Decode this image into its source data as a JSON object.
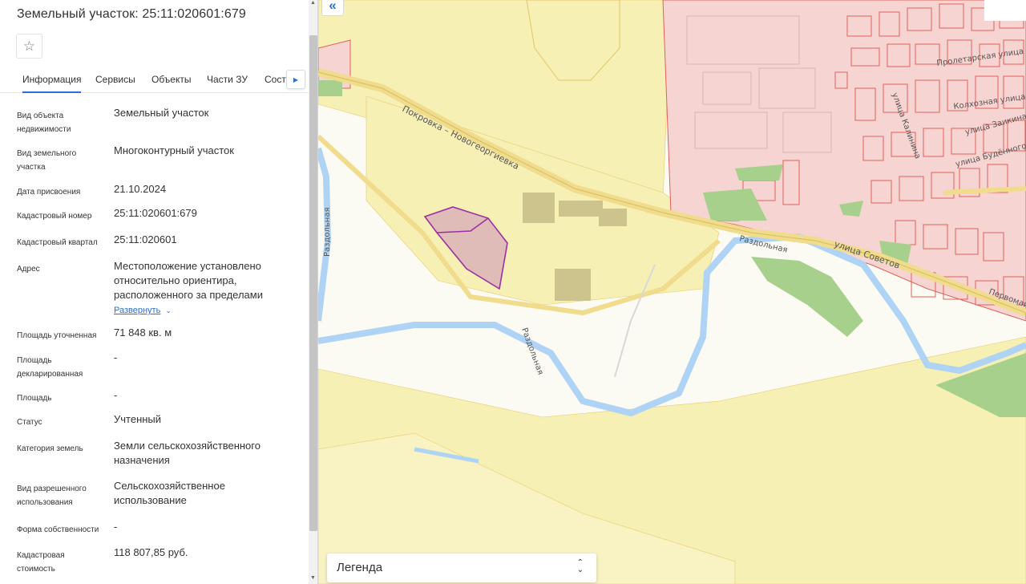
{
  "panel": {
    "title": "Земельный участок: 25:11:020601:679",
    "favorite_icon": "star-outline-icon",
    "tabs": [
      "Информация",
      "Сервисы",
      "Объекты",
      "Части ЗУ",
      "Соста"
    ],
    "active_tab": "Информация",
    "tabs_next_icon": "chevron-right-icon",
    "fields": [
      {
        "label": "Вид объекта недвижимости",
        "value": "Земельный участок"
      },
      {
        "label": "Вид земельного участка",
        "value": "Многоконтурный участок"
      },
      {
        "label": "Дата присвоения",
        "value": "21.10.2024"
      },
      {
        "label": "Кадастровый номер",
        "value": "25:11:020601:679"
      },
      {
        "label": "Кадастровый квартал",
        "value": "25:11:020601"
      },
      {
        "label": "Адрес",
        "value": "Местоположение установлено относительно ориентира, расположенного за пределами"
      },
      {
        "label": "Площадь уточненная",
        "value": "71 848 кв. м"
      },
      {
        "label": "Площадь декларированная",
        "value": "-"
      },
      {
        "label": "Площадь",
        "value": "-"
      },
      {
        "label": "Статус",
        "value": "Учтенный"
      },
      {
        "label": "Категория земель",
        "value": "Земли сельскохозяйственного назначения"
      },
      {
        "label": "Вид разрешенного использования",
        "value": "Сельскохозяйственное использование"
      },
      {
        "label": "Форма собственности",
        "value": "-"
      },
      {
        "label": "Кадастровая стоимость",
        "value": "118 807,85 руб."
      }
    ],
    "expand_link": "Развернуть",
    "expand_icon": "chevron-down-icon"
  },
  "map": {
    "collapse_icon": "double-chevron-left-icon",
    "labels": {
      "road_main": "Покровка – Новогеоргиевка",
      "street_sovetov": "улица Советов",
      "river_1": "Раздольная",
      "river_2": "Раздольная",
      "river_3": "Раздольная",
      "street_proletarskaya": "Пролетарская улица",
      "street_kolkhoznaya": "Колхозная улица",
      "street_zaikina": "улица Заикина",
      "street_budennogo": "улица Будённого",
      "street_kalinina": "улица Калинина",
      "street_pervomayskaya": "Первомайская"
    },
    "colors": {
      "agri_land": "#f7f0b4",
      "settlement": "#f6d4d2",
      "parcel_border": "#e0605a",
      "selected_parcel": "#9c2fa3",
      "river": "#aed3f4",
      "road": "#f0dc8c",
      "vegetation": "#a8d08d"
    }
  },
  "legend": {
    "label": "Легенда",
    "icon": "sort-arrows-icon"
  }
}
